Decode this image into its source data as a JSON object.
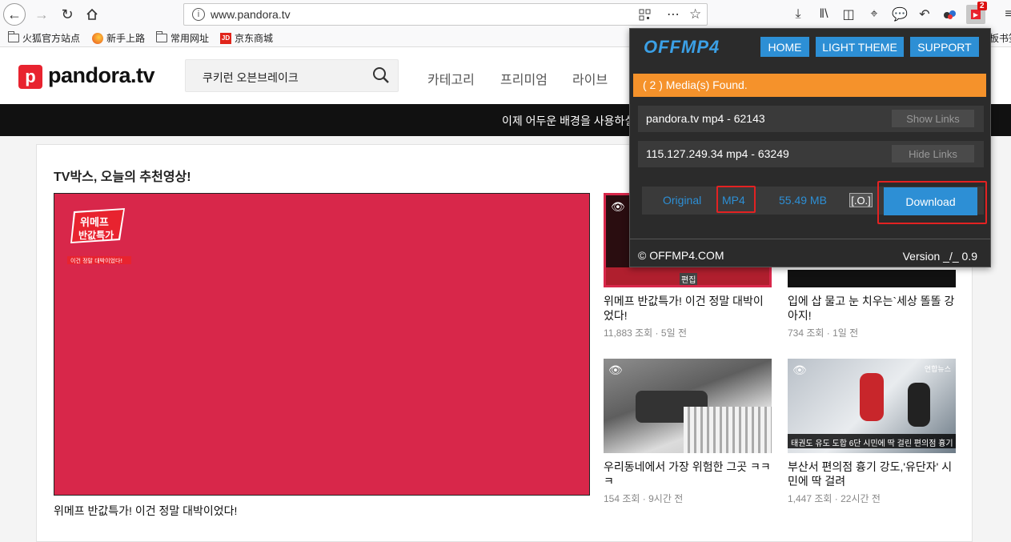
{
  "browser": {
    "url": "www.pandora.tv",
    "extension_badge": "2",
    "bookmarks": [
      {
        "label": "火狐官方站点",
        "icon": "folder-icon"
      },
      {
        "label": "新手上路",
        "icon": "firefox-icon"
      },
      {
        "label": "常用网址",
        "icon": "folder-icon"
      },
      {
        "label": "京东商城",
        "icon": "jd-icon"
      }
    ],
    "bookmark_overflow": "板书签"
  },
  "site": {
    "logo_letter": "p",
    "logo_text": "pandora.tv",
    "search_value": "쿠키런 오븐브레이크",
    "nav": [
      "카테고리",
      "프리미엄",
      "라이브"
    ],
    "banner_text": "이제 어두운 배경을 사용하실",
    "section_title": "TV박스, 오늘의 추천영상!",
    "main_badge": [
      "위메프",
      "반값특가",
      "이건 정말 대박이었다!"
    ],
    "main_caption": "위메프 반값특가! 이건 정말 대박이었다!",
    "videos": [
      {
        "title": "위메프 반값특가! 이건 정말 대박이었다!",
        "meta": "11,883 조회 · 5일 전",
        "thumb_text": "편집"
      },
      {
        "title": "입에 삽 물고 눈 치우는`세상 똘똘 강아지!",
        "meta": "734 조회 · 1일 전"
      },
      {
        "title": "우리동네에서 가장 위험한 그곳 ㅋㅋㅋ",
        "meta": "154 조회 · 9시간 전"
      },
      {
        "title": "부산서 편의점 흉기 강도,'유단자' 시민에 딱 걸려",
        "meta": "1,447 조회 · 22시간 전",
        "thumb_text": "태권도 유도 도합 6단 시민에 딱 걸린 편의점 흉기 강도",
        "thumb_corner": "연합뉴스"
      }
    ]
  },
  "popup": {
    "logo": "OFFMP4",
    "buttons": [
      "HOME",
      "LIGHT THEME",
      "SUPPORT"
    ],
    "found": "( 2 ) Media(s) Found.",
    "links": [
      {
        "label": "pandora.tv mp4 - 62143",
        "action": "Show Links"
      },
      {
        "label": "115.127.249.34 mp4 - 63249",
        "action": "Hide Links"
      }
    ],
    "download_row": {
      "quality": "Original",
      "format": "MP4",
      "size": "55.49 MB",
      "o_label": "[.O.]",
      "download": "Download"
    },
    "copyright": "© OFFMP4.COM",
    "version": "Version _/_ 0.9"
  }
}
